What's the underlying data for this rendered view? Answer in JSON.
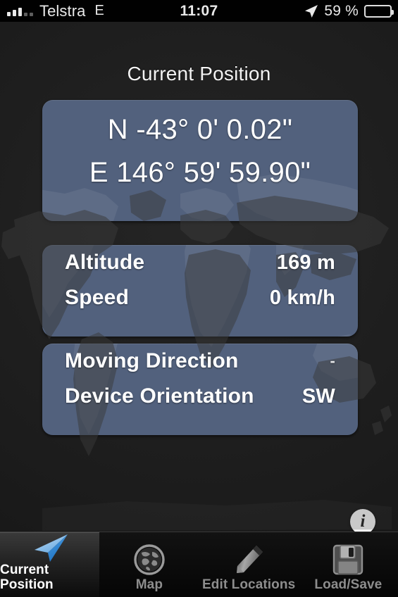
{
  "statusbar": {
    "carrier": "Telstra",
    "network_type": "E",
    "time": "11:07",
    "battery_percent": "59 %",
    "signal_bars_filled": 3,
    "signal_bars_total": 5,
    "battery_level": 0.5,
    "location_icon": "location-arrow-icon",
    "battery_icon": "battery-icon"
  },
  "header": {
    "title": "Current Position"
  },
  "coordinates": {
    "latitude": "N -43° 0' 0.02\"",
    "longitude": "E 146° 59' 59.90\""
  },
  "metrics": {
    "rows": [
      {
        "label": "Altitude",
        "value": "169 m"
      },
      {
        "label": "Speed",
        "value": "0 km/h"
      }
    ]
  },
  "orientation": {
    "rows": [
      {
        "label": "Moving Direction",
        "value": "-"
      },
      {
        "label": "Device Orientation",
        "value": "SW"
      }
    ]
  },
  "info_button": {
    "glyph": "i",
    "icon": "info-icon"
  },
  "tabbar": {
    "tabs": [
      {
        "label": "Current Position",
        "icon": "navigation-arrow-icon",
        "active": true
      },
      {
        "label": "Map",
        "icon": "globe-icon",
        "active": false
      },
      {
        "label": "Edit Locations",
        "icon": "pencil-icon",
        "active": false
      },
      {
        "label": "Load/Save",
        "icon": "floppy-disk-icon",
        "active": false
      }
    ]
  },
  "colors": {
    "panel": "#52617d",
    "background": "#1b1b1b",
    "accent_arrow": "#62b4ef",
    "text_primary": "#ffffff",
    "text_muted": "#8d8d8d"
  }
}
